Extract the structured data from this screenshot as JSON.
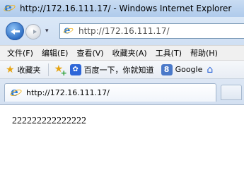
{
  "window": {
    "title": "http://172.16.111.17/ - Windows Internet Explorer"
  },
  "nav": {
    "dropdown_glyph": "▾",
    "address": "http://172.16.111.17/"
  },
  "menu": {
    "items": [
      {
        "label": "文件(F)"
      },
      {
        "label": "编辑(E)"
      },
      {
        "label": "查看(V)"
      },
      {
        "label": "收藏夹(A)"
      },
      {
        "label": "工具(T)"
      },
      {
        "label": "帮助(H)"
      }
    ]
  },
  "favorites": {
    "label": "收藏夹",
    "links": [
      {
        "label": "百度一下，你就知道",
        "icon": "baidu-paw-icon"
      },
      {
        "label": "Google",
        "icon": "google-g-icon"
      }
    ],
    "overflow_icon": "home-icon"
  },
  "tabs": [
    {
      "label": "http://172.16.111.17/"
    }
  ],
  "page": {
    "content": "222222222222222"
  },
  "colors": {
    "title_bar": "#b9d1ee",
    "accent": "#2a7bd6"
  }
}
